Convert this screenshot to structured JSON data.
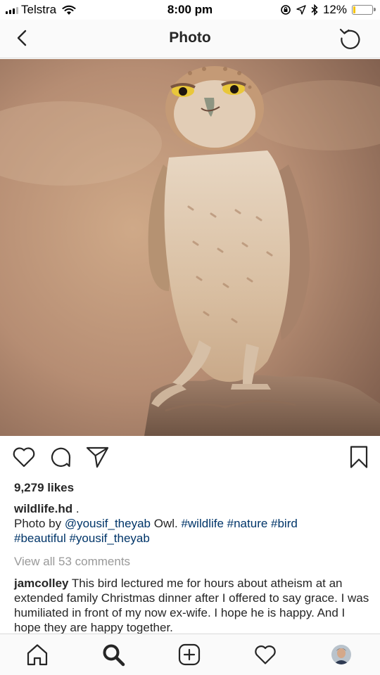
{
  "status_bar": {
    "carrier": "Telstra",
    "time": "8:00 pm",
    "battery_percent": "12%",
    "battery_level": 0.12,
    "icons": [
      "signal-icon",
      "wifi-icon",
      "orientation-lock-icon",
      "location-arrow-icon",
      "bluetooth-icon",
      "battery-icon"
    ]
  },
  "nav": {
    "title": "Photo",
    "back_icon": "chevron-left-icon",
    "refresh_icon": "refresh-icon"
  },
  "post": {
    "image_icon": "owl-photo",
    "actions": [
      "heart-icon",
      "comment-icon",
      "share-icon",
      "bookmark-icon"
    ],
    "likes": "9,279 likes",
    "author": "wildlife.hd",
    "author_suffix": " .",
    "caption_prefix": "Photo by ",
    "caption_mention": "@yousif_theyab",
    "caption_text": " Owl. ",
    "hashtags_line1": "#wildlife #nature #bird",
    "hashtags_line2": "#beautiful #yousif_theyab",
    "view_comments": "View all 53 comments",
    "comment": {
      "username": "jamcolley",
      "text": " This bird lectured me for hours about atheism at an extended family Christmas dinner after I offered to say grace. I was humiliated in front of my now ex-wife. I hope he is happy. And I hope they are happy together."
    }
  },
  "tab_bar": {
    "items": [
      "home-icon",
      "search-icon",
      "add-post-icon",
      "activity-heart-icon",
      "profile-avatar"
    ]
  },
  "colors": {
    "link": "#003569",
    "muted": "#999999",
    "text": "#262626",
    "battery_fill": "#f5c400"
  }
}
